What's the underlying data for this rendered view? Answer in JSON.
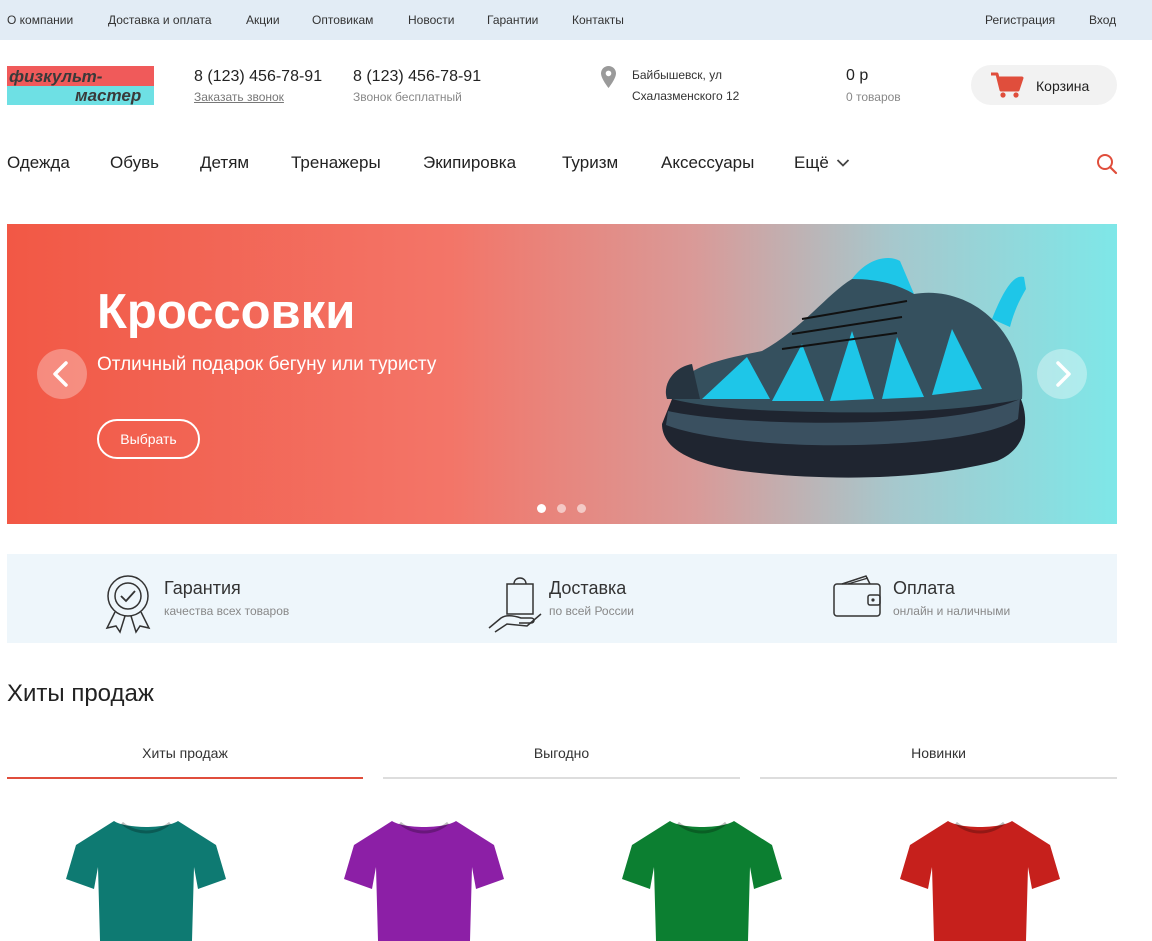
{
  "topbar": {
    "links": [
      "О компании",
      "Доставка и оплата",
      "Акции",
      "Оптовикам",
      "Новости",
      "Гарантии",
      "Контакты"
    ],
    "register": "Регистрация",
    "login": "Вход"
  },
  "header": {
    "logo_line1": "физкульт-",
    "logo_line2": "мастер",
    "phone1": "8 (123) 456-78-91",
    "callback": "Заказать звонок",
    "phone2": "8 (123) 456-78-91",
    "phone2_note": "Звонок бесплатный",
    "address_line1": "Байбышевск, ул",
    "address_line2": "Схалазменского 12",
    "cart_sum": "0 р",
    "cart_count": "0 товаров",
    "cart_label": "Корзина"
  },
  "nav": {
    "items": [
      "Одежда",
      "Обувь",
      "Детям",
      "Тренажеры",
      "Экипировка",
      "Туризм",
      "Аксессуары",
      "Ещё"
    ]
  },
  "hero": {
    "title": "Кроссовки",
    "subtitle": "Отличный подарок бегуну или туристу",
    "button": "Выбрать",
    "slides": 3,
    "active_slide": 1
  },
  "features": [
    {
      "title": "Гарантия",
      "sub": "качества всех товаров"
    },
    {
      "title": "Доставка",
      "sub": "по всей России"
    },
    {
      "title": "Оплата",
      "sub": "онлайн и наличными"
    }
  ],
  "hits": {
    "title": "Хиты продаж",
    "tabs": [
      "Хиты продаж",
      "Выгодно",
      "Новинки"
    ],
    "active_tab": 0,
    "product_colors": [
      "#0e7a72",
      "#8c1fa6",
      "#0c7f31",
      "#c6201c"
    ]
  },
  "colors": {
    "accent": "#e04e3c",
    "topbar_bg": "#e2ecf5",
    "features_bg": "#eef6fb"
  }
}
